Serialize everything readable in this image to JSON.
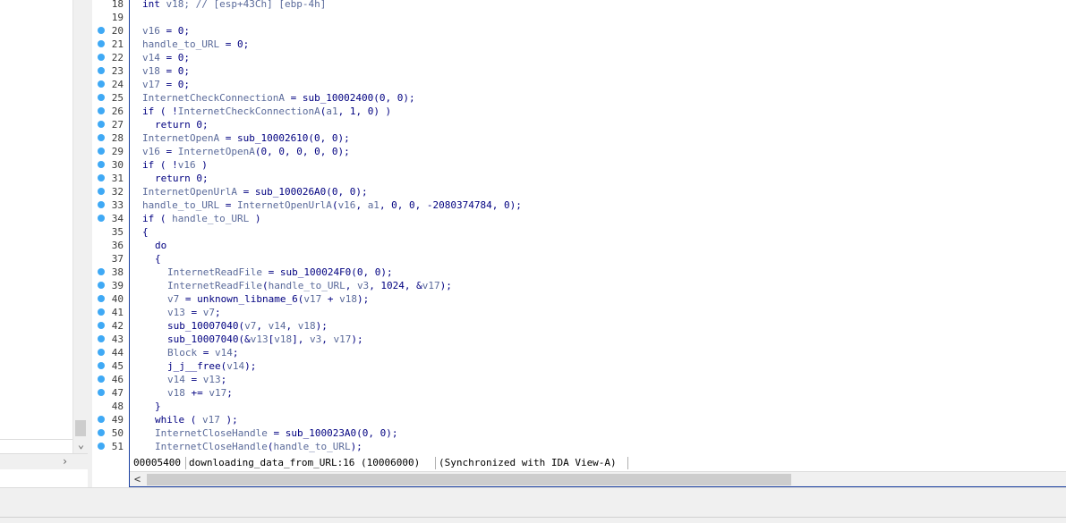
{
  "left_pane": {
    "scroll_down_glyph": "⌄",
    "scroll_right_glyph": "›"
  },
  "editor": {
    "lines": [
      {
        "num": "18",
        "dot": false,
        "indent": 0,
        "parts": [
          {
            "t": "int ",
            "c": "k"
          },
          {
            "t": "v18",
            "c": "v"
          },
          {
            "t": "; // [esp+43Ch] [ebp-4h]",
            "c": "v"
          }
        ]
      },
      {
        "num": "19",
        "dot": false,
        "indent": 0,
        "parts": []
      },
      {
        "num": "20",
        "dot": true,
        "indent": 0,
        "parts": [
          {
            "t": "v16",
            "c": "v"
          },
          {
            "t": " = 0;",
            "c": "k"
          }
        ]
      },
      {
        "num": "21",
        "dot": true,
        "indent": 0,
        "parts": [
          {
            "t": "handle_to_URL",
            "c": "v"
          },
          {
            "t": " = 0;",
            "c": "k"
          }
        ]
      },
      {
        "num": "22",
        "dot": true,
        "indent": 0,
        "parts": [
          {
            "t": "v14",
            "c": "v"
          },
          {
            "t": " = 0;",
            "c": "k"
          }
        ]
      },
      {
        "num": "23",
        "dot": true,
        "indent": 0,
        "parts": [
          {
            "t": "v18",
            "c": "v"
          },
          {
            "t": " = 0;",
            "c": "k"
          }
        ]
      },
      {
        "num": "24",
        "dot": true,
        "indent": 0,
        "parts": [
          {
            "t": "v17",
            "c": "v"
          },
          {
            "t": " = 0;",
            "c": "k"
          }
        ]
      },
      {
        "num": "25",
        "dot": true,
        "indent": 0,
        "parts": [
          {
            "t": "InternetCheckConnectionA",
            "c": "v"
          },
          {
            "t": " = sub_10002400(0, 0);",
            "c": "k"
          }
        ]
      },
      {
        "num": "26",
        "dot": true,
        "indent": 0,
        "parts": [
          {
            "t": "if ( !",
            "c": "k"
          },
          {
            "t": "InternetCheckConnectionA",
            "c": "v"
          },
          {
            "t": "(",
            "c": "k"
          },
          {
            "t": "a1",
            "c": "v"
          },
          {
            "t": ", 1, 0) )",
            "c": "k"
          }
        ]
      },
      {
        "num": "27",
        "dot": true,
        "indent": 1,
        "parts": [
          {
            "t": "return 0;",
            "c": "k"
          }
        ]
      },
      {
        "num": "28",
        "dot": true,
        "indent": 0,
        "parts": [
          {
            "t": "InternetOpenA",
            "c": "v"
          },
          {
            "t": " = sub_10002610(0, 0);",
            "c": "k"
          }
        ]
      },
      {
        "num": "29",
        "dot": true,
        "indent": 0,
        "parts": [
          {
            "t": "v16",
            "c": "v"
          },
          {
            "t": " = ",
            "c": "k"
          },
          {
            "t": "InternetOpenA",
            "c": "v"
          },
          {
            "t": "(0, 0, 0, 0, 0);",
            "c": "k"
          }
        ]
      },
      {
        "num": "30",
        "dot": true,
        "indent": 0,
        "parts": [
          {
            "t": "if ( !",
            "c": "k"
          },
          {
            "t": "v16",
            "c": "v"
          },
          {
            "t": " )",
            "c": "k"
          }
        ]
      },
      {
        "num": "31",
        "dot": true,
        "indent": 1,
        "parts": [
          {
            "t": "return 0;",
            "c": "k"
          }
        ]
      },
      {
        "num": "32",
        "dot": true,
        "indent": 0,
        "parts": [
          {
            "t": "InternetOpenUrlA",
            "c": "v"
          },
          {
            "t": " = sub_100026A0(0, 0);",
            "c": "k"
          }
        ]
      },
      {
        "num": "33",
        "dot": true,
        "indent": 0,
        "parts": [
          {
            "t": "handle_to_URL",
            "c": "v"
          },
          {
            "t": " = ",
            "c": "k"
          },
          {
            "t": "InternetOpenUrlA",
            "c": "v"
          },
          {
            "t": "(",
            "c": "k"
          },
          {
            "t": "v16",
            "c": "v"
          },
          {
            "t": ", ",
            "c": "k"
          },
          {
            "t": "a1",
            "c": "v"
          },
          {
            "t": ", 0, 0, -2080374784, 0);",
            "c": "k"
          }
        ]
      },
      {
        "num": "34",
        "dot": true,
        "indent": 0,
        "parts": [
          {
            "t": "if ( ",
            "c": "k"
          },
          {
            "t": "handle_to_URL",
            "c": "v"
          },
          {
            "t": " )",
            "c": "k"
          }
        ]
      },
      {
        "num": "35",
        "dot": false,
        "indent": 0,
        "parts": [
          {
            "t": "{",
            "c": "k"
          }
        ]
      },
      {
        "num": "36",
        "dot": false,
        "indent": 1,
        "parts": [
          {
            "t": "do",
            "c": "k"
          }
        ]
      },
      {
        "num": "37",
        "dot": false,
        "indent": 1,
        "parts": [
          {
            "t": "{",
            "c": "k"
          }
        ]
      },
      {
        "num": "38",
        "dot": true,
        "indent": 2,
        "parts": [
          {
            "t": "InternetReadFile",
            "c": "v"
          },
          {
            "t": " = sub_100024F0(0, 0);",
            "c": "k"
          }
        ]
      },
      {
        "num": "39",
        "dot": true,
        "indent": 2,
        "parts": [
          {
            "t": "InternetReadFile",
            "c": "v"
          },
          {
            "t": "(",
            "c": "k"
          },
          {
            "t": "handle_to_URL",
            "c": "v"
          },
          {
            "t": ", ",
            "c": "k"
          },
          {
            "t": "v3",
            "c": "v"
          },
          {
            "t": ", 1024, &",
            "c": "k"
          },
          {
            "t": "v17",
            "c": "v"
          },
          {
            "t": ");",
            "c": "k"
          }
        ]
      },
      {
        "num": "40",
        "dot": true,
        "indent": 2,
        "parts": [
          {
            "t": "v7",
            "c": "v"
          },
          {
            "t": " = unknown_libname_6(",
            "c": "k"
          },
          {
            "t": "v17",
            "c": "v"
          },
          {
            "t": " + ",
            "c": "k"
          },
          {
            "t": "v18",
            "c": "v"
          },
          {
            "t": ");",
            "c": "k"
          }
        ]
      },
      {
        "num": "41",
        "dot": true,
        "indent": 2,
        "parts": [
          {
            "t": "v13",
            "c": "v"
          },
          {
            "t": " = ",
            "c": "k"
          },
          {
            "t": "v7",
            "c": "v"
          },
          {
            "t": ";",
            "c": "k"
          }
        ]
      },
      {
        "num": "42",
        "dot": true,
        "indent": 2,
        "parts": [
          {
            "t": "sub_10007040(",
            "c": "k"
          },
          {
            "t": "v7",
            "c": "v"
          },
          {
            "t": ", ",
            "c": "k"
          },
          {
            "t": "v14",
            "c": "v"
          },
          {
            "t": ", ",
            "c": "k"
          },
          {
            "t": "v18",
            "c": "v"
          },
          {
            "t": ");",
            "c": "k"
          }
        ]
      },
      {
        "num": "43",
        "dot": true,
        "indent": 2,
        "parts": [
          {
            "t": "sub_10007040(&",
            "c": "k"
          },
          {
            "t": "v13",
            "c": "v"
          },
          {
            "t": "[",
            "c": "k"
          },
          {
            "t": "v18",
            "c": "v"
          },
          {
            "t": "], ",
            "c": "k"
          },
          {
            "t": "v3",
            "c": "v"
          },
          {
            "t": ", ",
            "c": "k"
          },
          {
            "t": "v17",
            "c": "v"
          },
          {
            "t": ");",
            "c": "k"
          }
        ]
      },
      {
        "num": "44",
        "dot": true,
        "indent": 2,
        "parts": [
          {
            "t": "Block",
            "c": "v"
          },
          {
            "t": " = ",
            "c": "k"
          },
          {
            "t": "v14",
            "c": "v"
          },
          {
            "t": ";",
            "c": "k"
          }
        ]
      },
      {
        "num": "45",
        "dot": true,
        "indent": 2,
        "parts": [
          {
            "t": "j_j__free(",
            "c": "k"
          },
          {
            "t": "v14",
            "c": "v"
          },
          {
            "t": ");",
            "c": "k"
          }
        ]
      },
      {
        "num": "46",
        "dot": true,
        "indent": 2,
        "parts": [
          {
            "t": "v14",
            "c": "v"
          },
          {
            "t": " = ",
            "c": "k"
          },
          {
            "t": "v13",
            "c": "v"
          },
          {
            "t": ";",
            "c": "k"
          }
        ]
      },
      {
        "num": "47",
        "dot": true,
        "indent": 2,
        "parts": [
          {
            "t": "v18",
            "c": "v"
          },
          {
            "t": " += ",
            "c": "k"
          },
          {
            "t": "v17",
            "c": "v"
          },
          {
            "t": ";",
            "c": "k"
          }
        ]
      },
      {
        "num": "48",
        "dot": false,
        "indent": 1,
        "parts": [
          {
            "t": "}",
            "c": "k"
          }
        ]
      },
      {
        "num": "49",
        "dot": true,
        "indent": 1,
        "parts": [
          {
            "t": "while ( ",
            "c": "k"
          },
          {
            "t": "v17",
            "c": "v"
          },
          {
            "t": " );",
            "c": "k"
          }
        ]
      },
      {
        "num": "50",
        "dot": true,
        "indent": 1,
        "parts": [
          {
            "t": "InternetCloseHandle",
            "c": "v"
          },
          {
            "t": " = sub_100023A0(0, 0);",
            "c": "k"
          }
        ]
      },
      {
        "num": "51",
        "dot": true,
        "indent": 1,
        "parts": [
          {
            "t": "InternetCloseHandle",
            "c": "v"
          },
          {
            "t": "(",
            "c": "k"
          },
          {
            "t": "handle_to_URL",
            "c": "v"
          },
          {
            "t": ");",
            "c": "k"
          }
        ]
      }
    ]
  },
  "status": {
    "address": "00005400",
    "location": "downloading_data_from_URL:16 (10006000)",
    "sync": "(Synchronized with IDA View-A)"
  },
  "hscroll": {
    "left_glyph": "<"
  },
  "colors": {
    "breakpoint_dot": "#3fa9f5",
    "keyword": "#000080",
    "variable": "#5a6a9a",
    "accent_border": "#1a3fa0"
  }
}
